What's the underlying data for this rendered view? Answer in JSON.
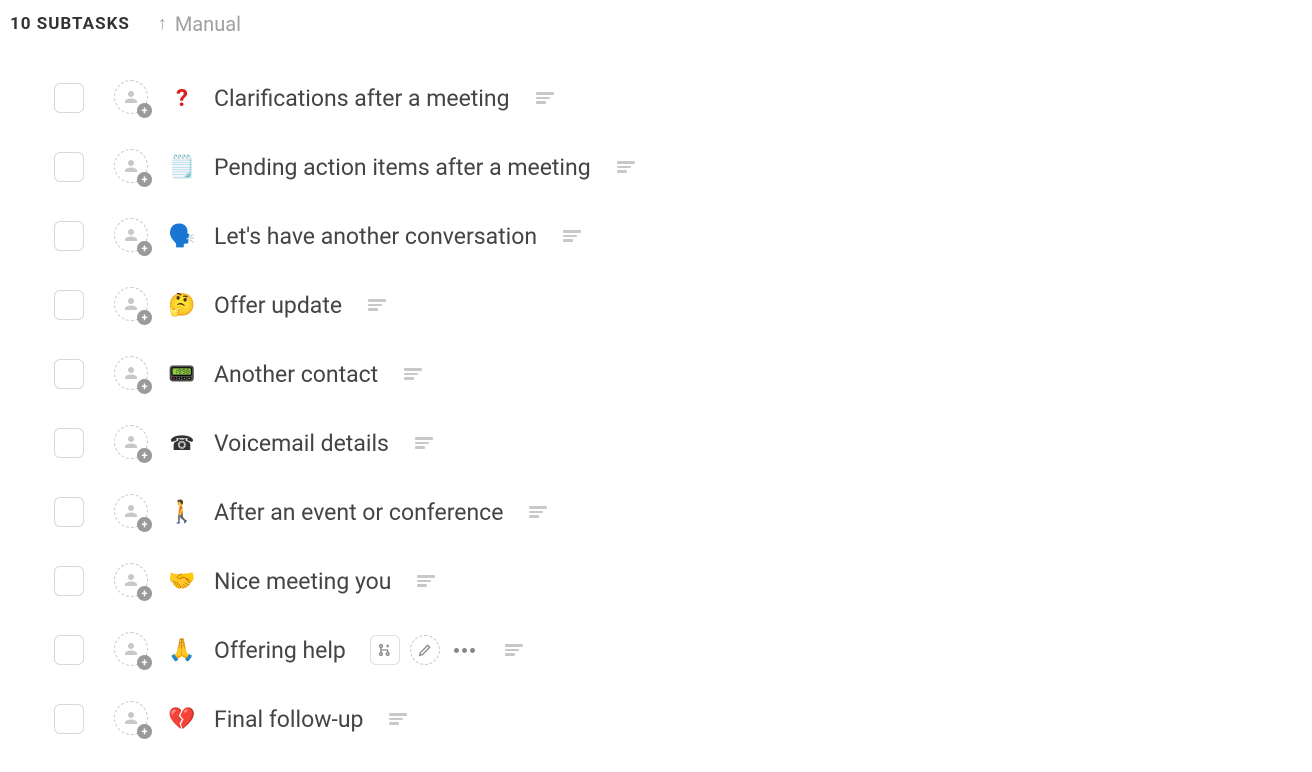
{
  "header": {
    "count_label": "10 SUBTASKS",
    "sort_label": "Manual"
  },
  "tasks": [
    {
      "emoji": "❓",
      "emoji_class": "question-mark",
      "title": "Clarifications after a meeting",
      "hover": false
    },
    {
      "emoji": "🗒️",
      "emoji_class": "",
      "title": "Pending action items after a meeting",
      "hover": false
    },
    {
      "emoji": "🗣️",
      "emoji_class": "",
      "title": "Let's have another conversation",
      "hover": false
    },
    {
      "emoji": "🤔",
      "emoji_class": "",
      "title": "Offer update",
      "hover": false
    },
    {
      "emoji": "📟",
      "emoji_class": "",
      "title": "Another contact",
      "hover": false
    },
    {
      "emoji": "☎",
      "emoji_class": "phone-glyph",
      "title": "Voicemail details",
      "hover": false
    },
    {
      "emoji": "🚶",
      "emoji_class": "",
      "title": "After an event or conference",
      "hover": false
    },
    {
      "emoji": "🤝",
      "emoji_class": "",
      "title": "Nice meeting you",
      "hover": false
    },
    {
      "emoji": "🙏",
      "emoji_class": "",
      "title": "Offering help",
      "hover": true
    },
    {
      "emoji": "💔",
      "emoji_class": "",
      "title": "Final follow-up",
      "hover": false
    }
  ]
}
